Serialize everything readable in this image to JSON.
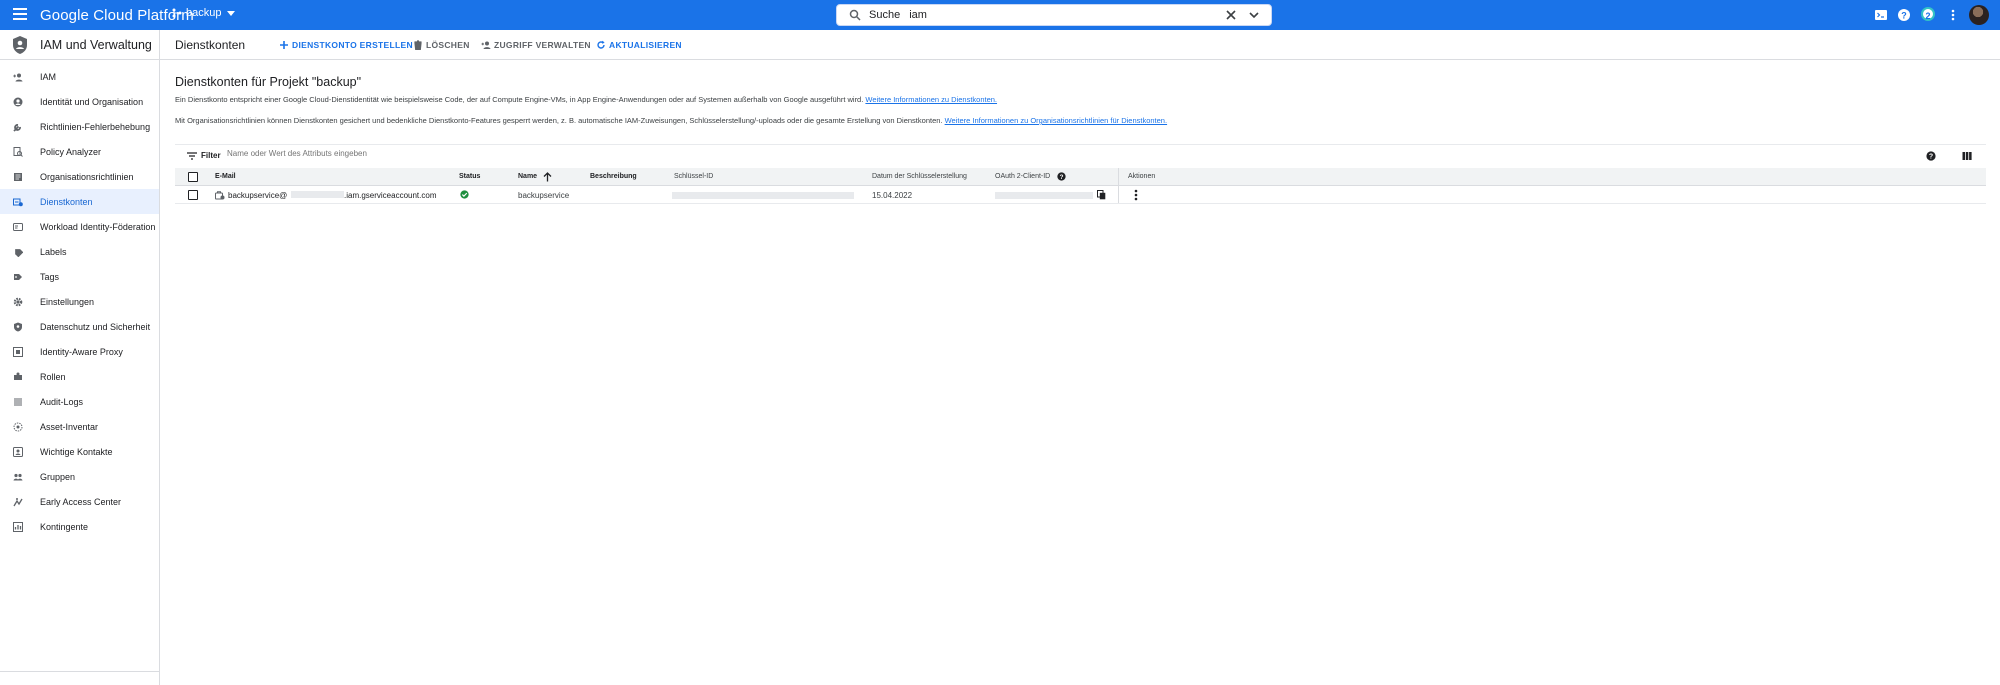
{
  "topbar": {
    "brand": "Google Cloud Platform",
    "project": "backup",
    "search_label": "Suche",
    "search_value": "iam",
    "notification_count": "2"
  },
  "sidebar": {
    "title": "IAM und Verwaltung",
    "items": [
      {
        "label": "IAM",
        "icon": "person-add-icon"
      },
      {
        "label": "Identität und Organisation",
        "icon": "account-circle-icon"
      },
      {
        "label": "Richtlinien-Fehlerbehebung",
        "icon": "wrench-icon"
      },
      {
        "label": "Policy Analyzer",
        "icon": "policy-search-icon"
      },
      {
        "label": "Organisationsrichtlinien",
        "icon": "list-document-icon"
      },
      {
        "label": "Dienstkonten",
        "icon": "service-account-icon",
        "active": true
      },
      {
        "label": "Workload Identity-Föderation",
        "icon": "id-card-icon"
      },
      {
        "label": "Labels",
        "icon": "label-icon"
      },
      {
        "label": "Tags",
        "icon": "tag-icon"
      },
      {
        "label": "Einstellungen",
        "icon": "gear-icon"
      },
      {
        "label": "Datenschutz und Sicherheit",
        "icon": "shield-icon"
      },
      {
        "label": "Identity-Aware Proxy",
        "icon": "proxy-icon"
      },
      {
        "label": "Rollen",
        "icon": "roles-icon"
      },
      {
        "label": "Audit-Logs",
        "icon": "lines-icon"
      },
      {
        "label": "Asset-Inventar",
        "icon": "asset-icon"
      },
      {
        "label": "Wichtige Kontakte",
        "icon": "contact-icon"
      },
      {
        "label": "Gruppen",
        "icon": "group-icon"
      },
      {
        "label": "Early Access Center",
        "icon": "early-access-icon"
      },
      {
        "label": "Kontingente",
        "icon": "quota-icon"
      }
    ]
  },
  "header": {
    "title": "Dienstkonten",
    "actions": {
      "create": "DIENSTKONTO ERSTELLEN",
      "delete": "LÖSCHEN",
      "manage_access": "ZUGRIFF VERWALTEN",
      "refresh": "AKTUALISIEREN"
    }
  },
  "content": {
    "title": "Dienstkonten für Projekt \"backup\"",
    "para1": "Ein Dienstkonto entspricht einer Google Cloud-Dienstidentität wie beispielsweise Code, der auf Compute Engine-VMs, in App Engine-Anwendungen oder auf Systemen außerhalb von Google ausgeführt wird.",
    "para1_link": "Weitere Informationen zu Dienstkonten.",
    "para2": "Mit Organisationsrichtlinien können Dienstkonten gesichert und bedenkliche Dienstkonto-Features gesperrt werden, z. B. automatische IAM-Zuweisungen, Schlüsselerstellung/-uploads oder die gesamte Erstellung von Dienstkonten.",
    "para2_link": "Weitere Informationen zu Organisationsrichtlinien für Dienstkonten."
  },
  "table": {
    "filter_label": "Filter",
    "filter_placeholder": "Name oder Wert des Attributs eingeben",
    "columns": {
      "email": "E-Mail",
      "status": "Status",
      "name": "Name",
      "description": "Beschreibung",
      "key_id": "Schlüssel-ID",
      "key_date": "Datum der Schlüsselerstellung",
      "oauth": "OAuth 2-Client-ID",
      "actions": "Aktionen"
    },
    "rows": [
      {
        "email_prefix": "backupservice@",
        "email_suffix": ".iam.gserviceaccount.com",
        "status": "enabled",
        "name": "backupservice",
        "description": "",
        "key_date": "15.04.2022"
      }
    ]
  },
  "colors": {
    "topbar": "#1a73e8",
    "accent": "#1a73e8",
    "active_bg": "#e8f0fe",
    "status_ok": "#1e8e3e"
  }
}
